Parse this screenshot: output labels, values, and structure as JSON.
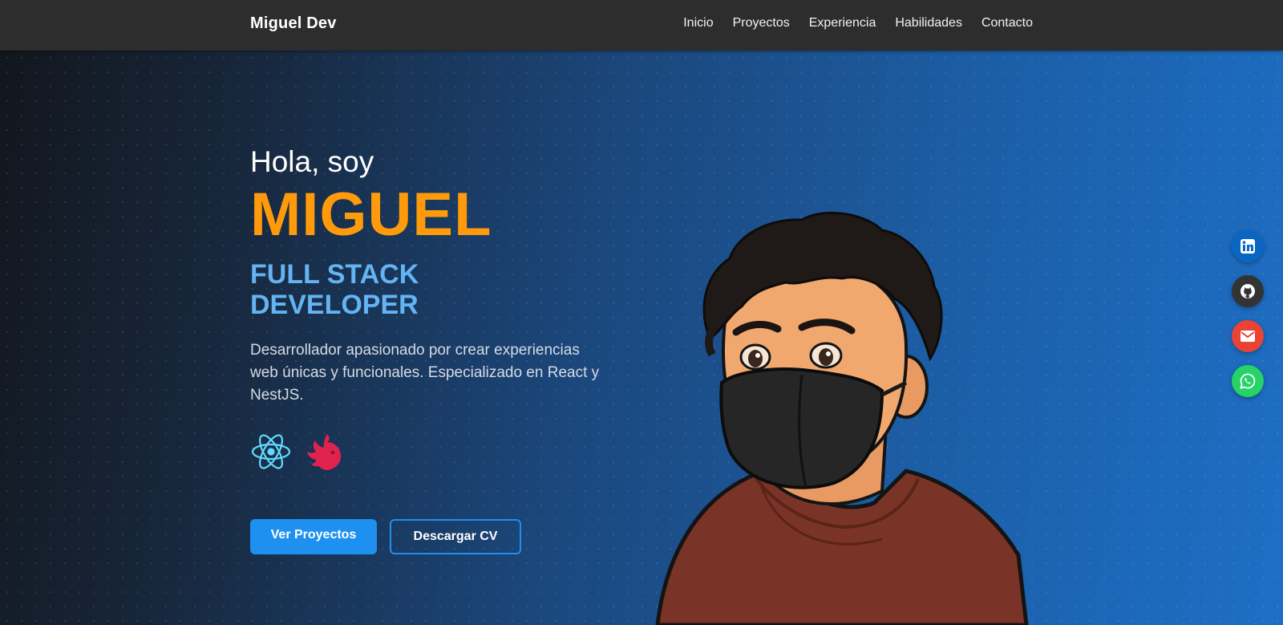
{
  "navbar": {
    "brand": "Miguel Dev",
    "links": [
      "Inicio",
      "Proyectos",
      "Experiencia",
      "Habilidades",
      "Contacto"
    ]
  },
  "hero": {
    "greeting": "Hola, soy",
    "name": "MIGUEL",
    "role": "FULL STACK DEVELOPER",
    "description": "Desarrollador apasionado por crear experiencias web únicas y funcionales. Especializado en React y NestJS.",
    "techs": [
      "react-icon",
      "nestjs-icon"
    ],
    "primary_button": "Ver Proyectos",
    "secondary_button": "Descargar CV"
  },
  "social": [
    "linkedin-icon",
    "github-icon",
    "mail-icon",
    "whatsapp-icon"
  ],
  "colors": {
    "accent": "#1e90f0",
    "name": "#ff9a0b",
    "role": "#64b3f2",
    "linkedin": "#0a66c2",
    "github": "#333333",
    "mail": "#ea4335",
    "whatsapp": "#25d366"
  }
}
